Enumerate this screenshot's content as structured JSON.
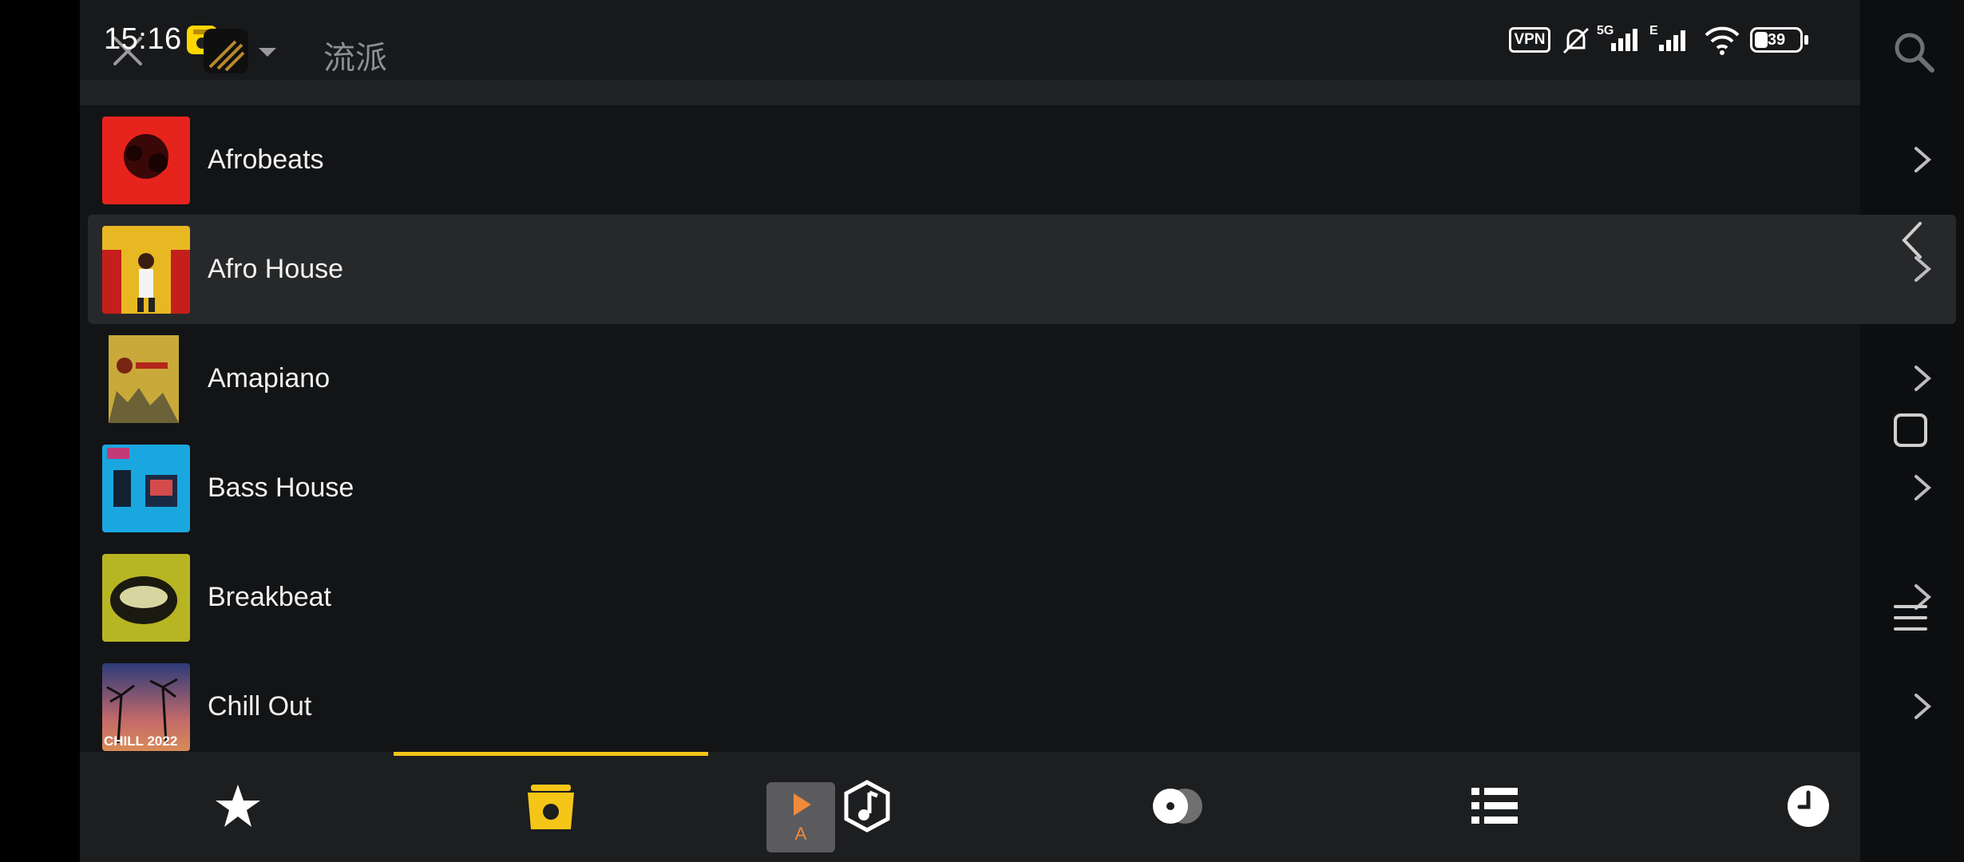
{
  "status_bar": {
    "time": "15:16",
    "vpn": "VPN",
    "network": "5G",
    "network2": "E",
    "battery": "39"
  },
  "header": {
    "title": "流派"
  },
  "genres": [
    {
      "label": "Afrobeats",
      "thumb_color": "#e6231d"
    },
    {
      "label": "Afro House",
      "thumb_color": "#e8b822"
    },
    {
      "label": "Amapiano",
      "thumb_color": "#c9a93a"
    },
    {
      "label": "Bass House",
      "thumb_color": "#1aa7e0"
    },
    {
      "label": "Breakbeat",
      "thumb_color": "#b8b523"
    },
    {
      "label": "Chill Out",
      "thumb_color": "#3c3f7a"
    }
  ],
  "thumb_texts": {
    "chill": "CHILL 2022"
  },
  "mini_player": {
    "label": "A"
  },
  "colors": {
    "accent": "#f5c518",
    "background": "#131416",
    "highlight_row": "#27282a"
  },
  "tabs": [
    {
      "icon": "star-icon",
      "selected": false
    },
    {
      "icon": "folder-icon",
      "selected": true
    },
    {
      "icon": "music-note-icon",
      "selected": false
    },
    {
      "icon": "vinyl-icon",
      "selected": false
    },
    {
      "icon": "list-icon",
      "selected": false
    },
    {
      "icon": "clock-icon",
      "selected": false
    }
  ]
}
